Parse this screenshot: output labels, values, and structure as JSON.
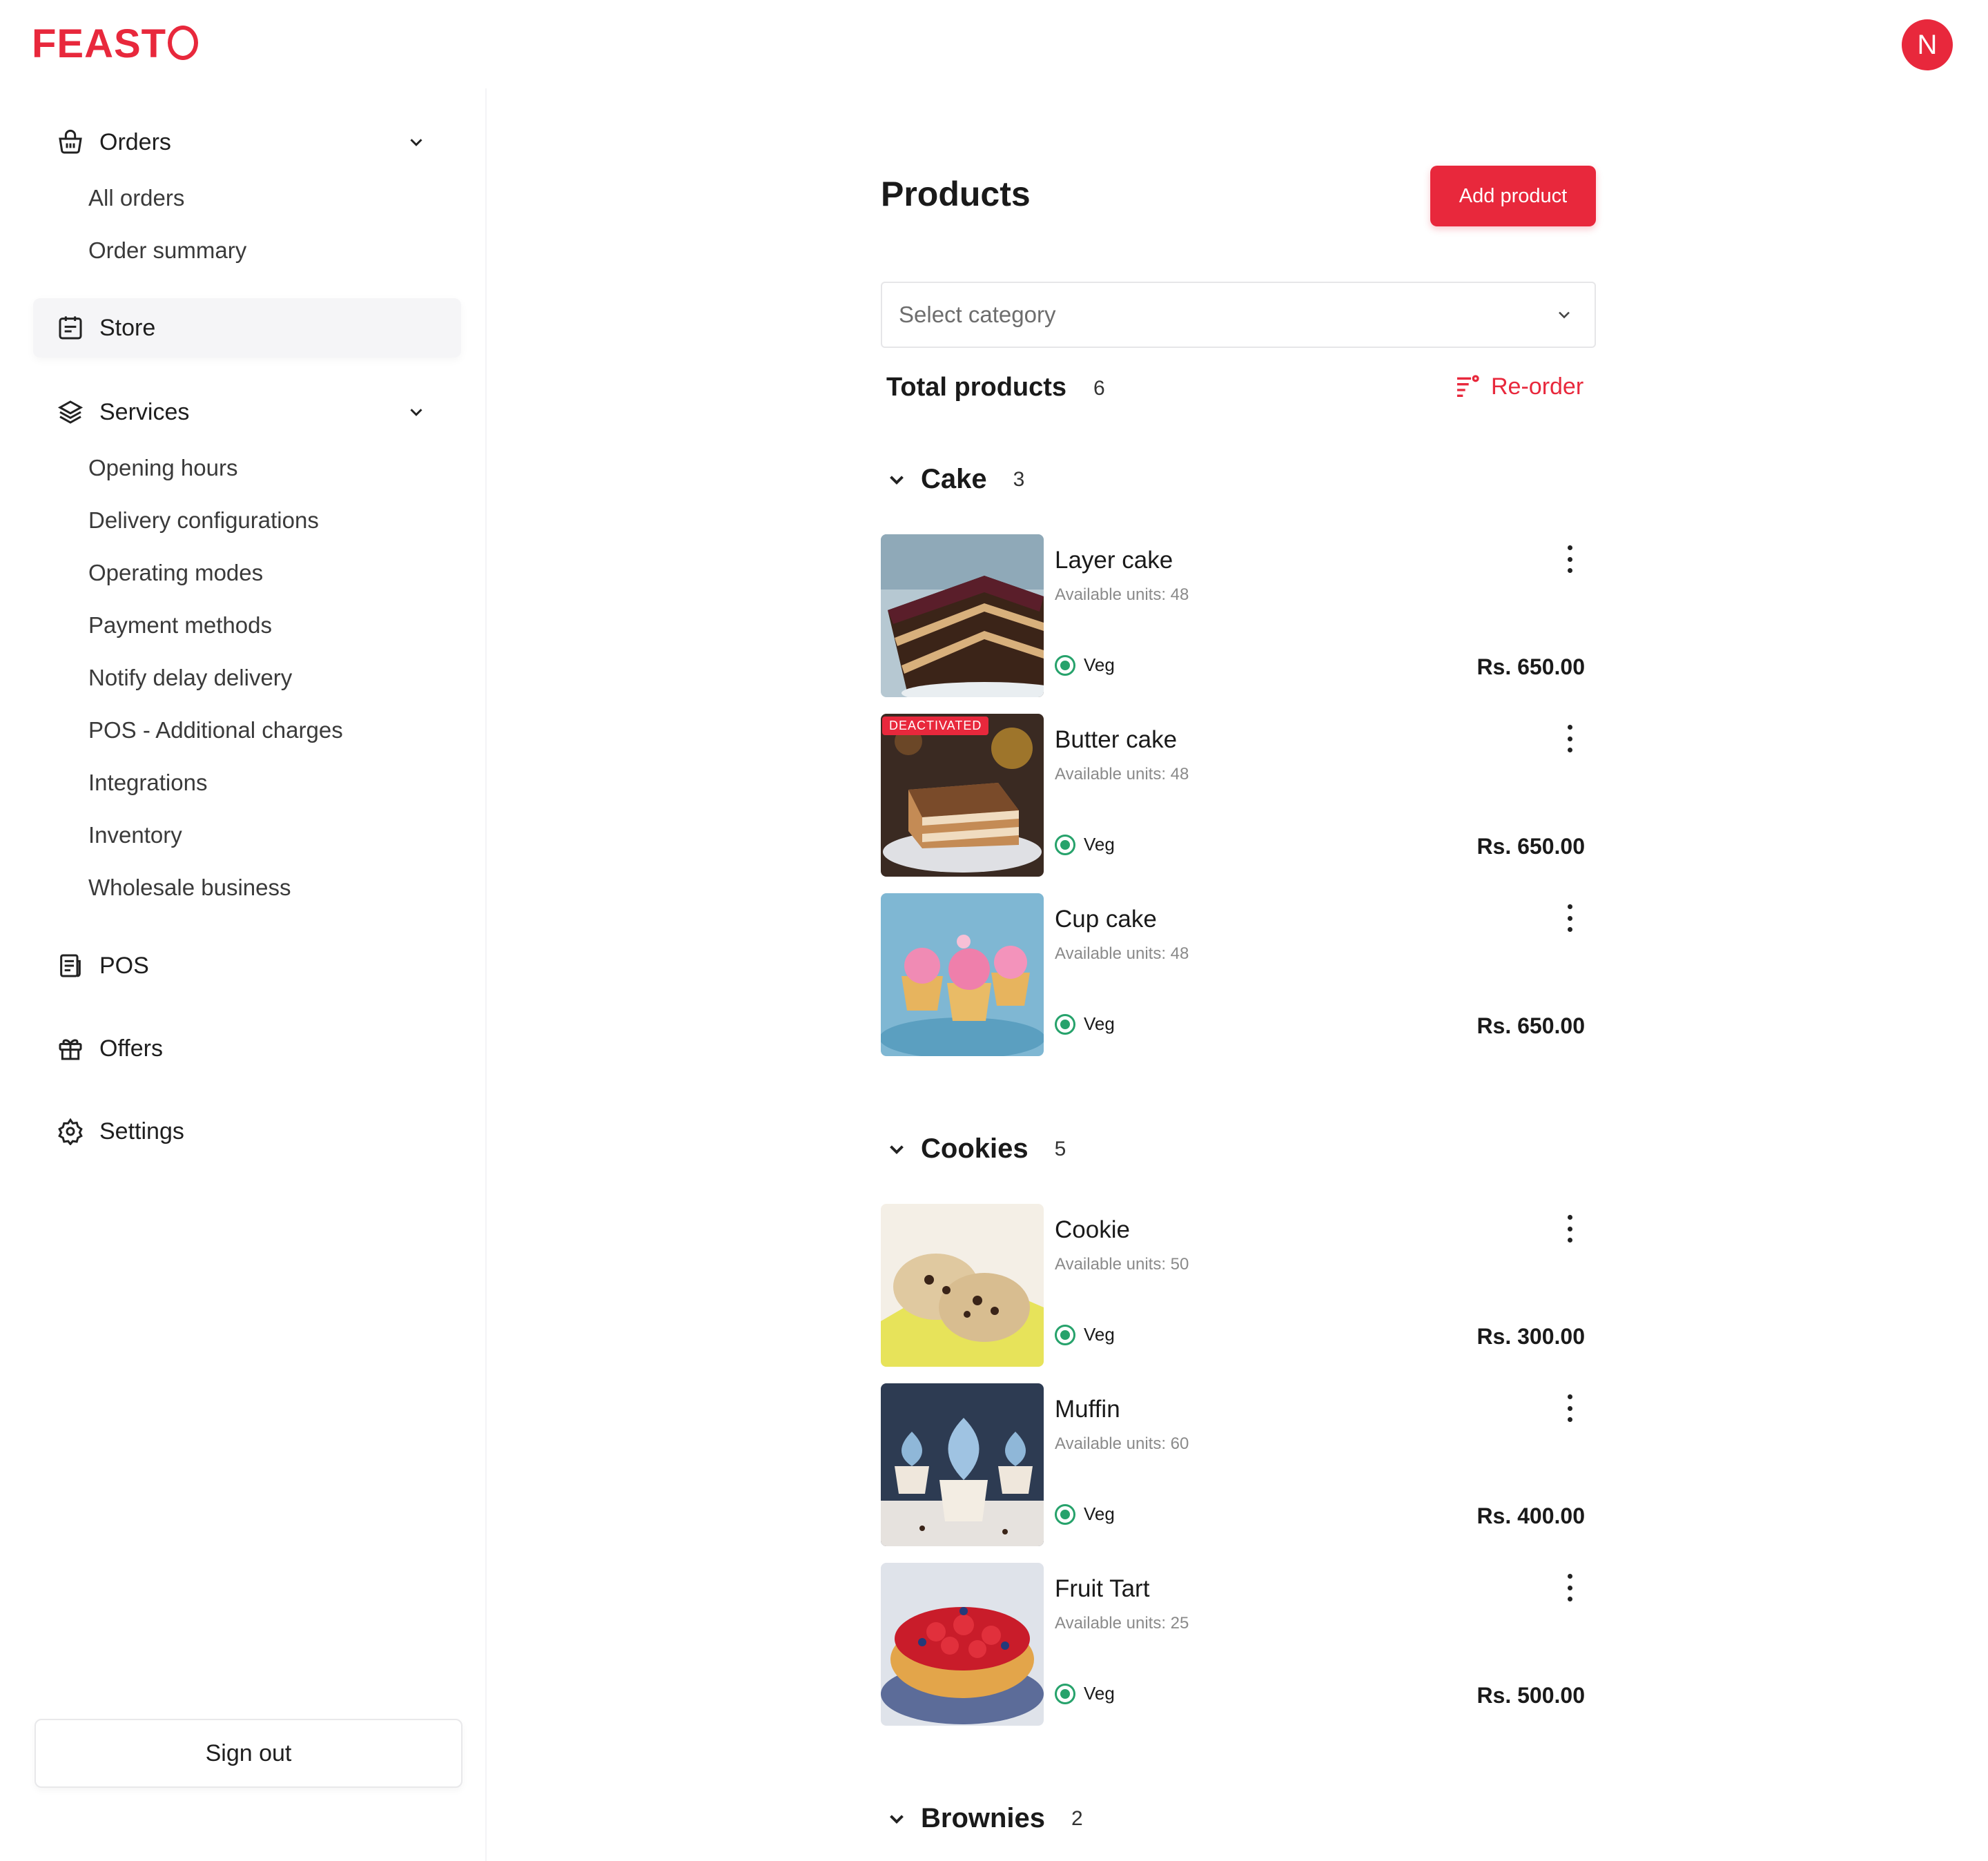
{
  "brand": {
    "name": "FEAST",
    "accent": "#e8283c"
  },
  "user": {
    "initial": "N"
  },
  "sidebar": {
    "orders": {
      "label": "Orders",
      "items": [
        "All orders",
        "Order summary"
      ]
    },
    "store": {
      "label": "Store"
    },
    "services": {
      "label": "Services",
      "items": [
        "Opening hours",
        "Delivery configurations",
        "Operating  modes",
        "Payment methods",
        "Notify delay delivery",
        "POS - Additional charges",
        "Integrations",
        "Inventory",
        "Wholesale business"
      ]
    },
    "pos": {
      "label": "POS"
    },
    "offers": {
      "label": "Offers"
    },
    "settings": {
      "label": "Settings"
    },
    "signout": "Sign out"
  },
  "main": {
    "title": "Products",
    "add_button": "Add product",
    "category_placeholder": "Select category",
    "total_label": "Total products",
    "total_count": "6",
    "reorder": "Re-order",
    "categories": [
      {
        "name": "Cake",
        "count": "3",
        "products": [
          {
            "name": "Layer cake",
            "units": "Available units: 48",
            "tag": "Veg",
            "price": "Rs. 650.00",
            "badge": ""
          },
          {
            "name": "Butter cake",
            "units": "Available units: 48",
            "tag": "Veg",
            "price": "Rs. 650.00",
            "badge": "DEACTIVATED"
          },
          {
            "name": "Cup cake",
            "units": "Available units: 48",
            "tag": "Veg",
            "price": "Rs. 650.00",
            "badge": ""
          }
        ]
      },
      {
        "name": "Cookies",
        "count": "5",
        "products": [
          {
            "name": "Cookie",
            "units": "Available units: 50",
            "tag": "Veg",
            "price": "Rs. 300.00",
            "badge": ""
          },
          {
            "name": "Muffin",
            "units": "Available units: 60",
            "tag": "Veg",
            "price": "Rs. 400.00",
            "badge": ""
          },
          {
            "name": "Fruit Tart",
            "units": "Available units: 25",
            "tag": "Veg",
            "price": "Rs. 500.00",
            "badge": ""
          }
        ]
      },
      {
        "name": "Brownies",
        "count": "2",
        "products": []
      }
    ]
  },
  "colors": {
    "veg": "#26a26b",
    "text": "#1a1a1a",
    "muted": "#8a8a8a"
  }
}
